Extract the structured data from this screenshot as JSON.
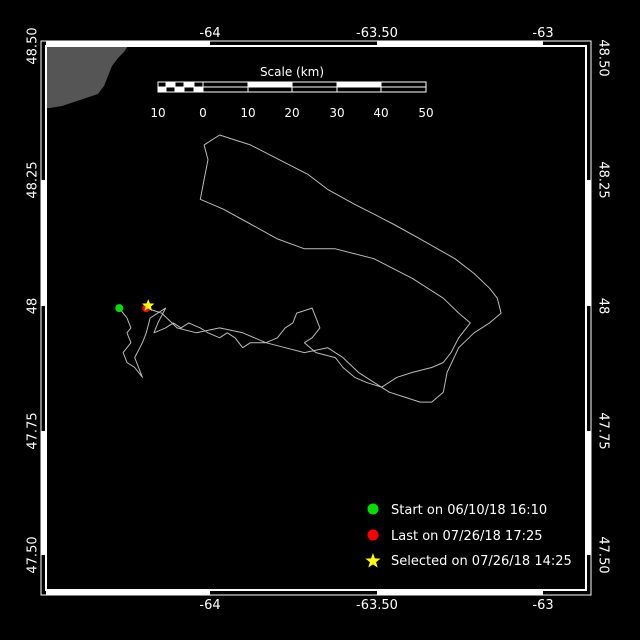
{
  "map": {
    "lon_range": [
      -64.25,
      -62.85
    ],
    "lat_range": [
      47.4,
      48.5
    ],
    "lon_ticks": [
      "-64",
      "-63.50",
      "-63"
    ],
    "lat_ticks": [
      "48.50",
      "48.25",
      "48",
      "47.75",
      "47.50"
    ],
    "background_color": "#000000",
    "frame_color": "#ffffff",
    "land_color": "#555555",
    "track_color": "#bbbbbb"
  },
  "scale_bar": {
    "title": "Scale (km)",
    "labels": [
      "10",
      "0",
      "10",
      "20",
      "30",
      "40",
      "50"
    ]
  },
  "track": {
    "points": [
      [
        -64.06,
        47.97
      ],
      [
        -64.05,
        47.96
      ],
      [
        -64.04,
        47.95
      ],
      [
        -64.03,
        47.93
      ],
      [
        -64.04,
        47.92
      ],
      [
        -64.03,
        47.9
      ],
      [
        -64.05,
        47.88
      ],
      [
        -64.04,
        47.86
      ],
      [
        -64.02,
        47.85
      ],
      [
        -64.0,
        47.83
      ],
      [
        -64.02,
        47.87
      ],
      [
        -64.0,
        47.9
      ],
      [
        -63.99,
        47.92
      ],
      [
        -63.98,
        47.95
      ],
      [
        -63.96,
        47.96
      ],
      [
        -63.94,
        47.97
      ],
      [
        -63.96,
        47.94
      ],
      [
        -63.97,
        47.92
      ],
      [
        -63.94,
        47.93
      ],
      [
        -63.92,
        47.94
      ],
      [
        -63.9,
        47.93
      ],
      [
        -63.88,
        47.94
      ],
      [
        -63.85,
        47.93
      ],
      [
        -63.83,
        47.92
      ],
      [
        -63.8,
        47.91
      ],
      [
        -63.78,
        47.92
      ],
      [
        -63.76,
        47.91
      ],
      [
        -63.74,
        47.89
      ],
      [
        -63.72,
        47.9
      ],
      [
        -63.68,
        47.9
      ],
      [
        -63.65,
        47.91
      ],
      [
        -63.63,
        47.93
      ],
      [
        -63.61,
        47.94
      ],
      [
        -63.6,
        47.96
      ],
      [
        -63.56,
        47.97
      ],
      [
        -63.54,
        47.93
      ],
      [
        -63.56,
        47.91
      ],
      [
        -63.58,
        47.9
      ],
      [
        -63.55,
        47.88
      ],
      [
        -63.5,
        47.87
      ],
      [
        -63.48,
        47.85
      ],
      [
        -63.45,
        47.83
      ],
      [
        -63.42,
        47.82
      ],
      [
        -63.38,
        47.81
      ],
      [
        -63.34,
        47.83
      ],
      [
        -63.3,
        47.84
      ],
      [
        -63.25,
        47.85
      ],
      [
        -63.22,
        47.86
      ],
      [
        -63.2,
        47.88
      ],
      [
        -63.18,
        47.91
      ],
      [
        -63.15,
        47.94
      ],
      [
        -63.18,
        47.96
      ],
      [
        -63.22,
        47.99
      ],
      [
        -63.3,
        48.03
      ],
      [
        -63.4,
        48.07
      ],
      [
        -63.5,
        48.09
      ],
      [
        -63.58,
        48.09
      ],
      [
        -63.65,
        48.11
      ],
      [
        -63.72,
        48.14
      ],
      [
        -63.79,
        48.17
      ],
      [
        -63.85,
        48.19
      ],
      [
        -63.84,
        48.23
      ],
      [
        -63.83,
        48.27
      ],
      [
        -63.84,
        48.3
      ],
      [
        -63.8,
        48.32
      ],
      [
        -63.76,
        48.31
      ],
      [
        -63.72,
        48.3
      ],
      [
        -63.67,
        48.28
      ],
      [
        -63.62,
        48.26
      ],
      [
        -63.57,
        48.24
      ],
      [
        -63.52,
        48.21
      ],
      [
        -63.45,
        48.18
      ],
      [
        -63.4,
        48.16
      ],
      [
        -63.35,
        48.14
      ],
      [
        -63.28,
        48.11
      ],
      [
        -63.19,
        48.07
      ],
      [
        -63.14,
        48.04
      ],
      [
        -63.1,
        48.01
      ],
      [
        -63.08,
        47.99
      ],
      [
        -63.07,
        47.96
      ],
      [
        -63.1,
        47.94
      ],
      [
        -63.14,
        47.92
      ],
      [
        -63.18,
        47.89
      ],
      [
        -63.21,
        47.84
      ],
      [
        -63.22,
        47.8
      ],
      [
        -63.25,
        47.78
      ],
      [
        -63.28,
        47.78
      ],
      [
        -63.32,
        47.79
      ],
      [
        -63.36,
        47.8
      ],
      [
        -63.4,
        47.82
      ],
      [
        -63.44,
        47.84
      ],
      [
        -63.48,
        47.87
      ],
      [
        -63.52,
        47.89
      ],
      [
        -63.58,
        47.88
      ],
      [
        -63.63,
        47.89
      ],
      [
        -63.68,
        47.9
      ],
      [
        -63.74,
        47.92
      ],
      [
        -63.8,
        47.93
      ],
      [
        -63.86,
        47.92
      ],
      [
        -63.91,
        47.93
      ],
      [
        -63.95,
        47.96
      ],
      [
        -63.99,
        47.97
      ]
    ]
  },
  "markers": [
    {
      "kind": "start",
      "lon": -64.06,
      "lat": 47.97,
      "color": "#00e000",
      "shape": "circle",
      "label": "Start on 06/10/18 16:10"
    },
    {
      "kind": "last",
      "lon": -63.99,
      "lat": 47.97,
      "color": "#ff0000",
      "shape": "circle",
      "label": "Last on 07/26/18 17:25"
    },
    {
      "kind": "selected",
      "lon": -63.985,
      "lat": 47.975,
      "color": "#ffff00",
      "shape": "star",
      "label": "Selected on 07/26/18 14:25"
    }
  ]
}
